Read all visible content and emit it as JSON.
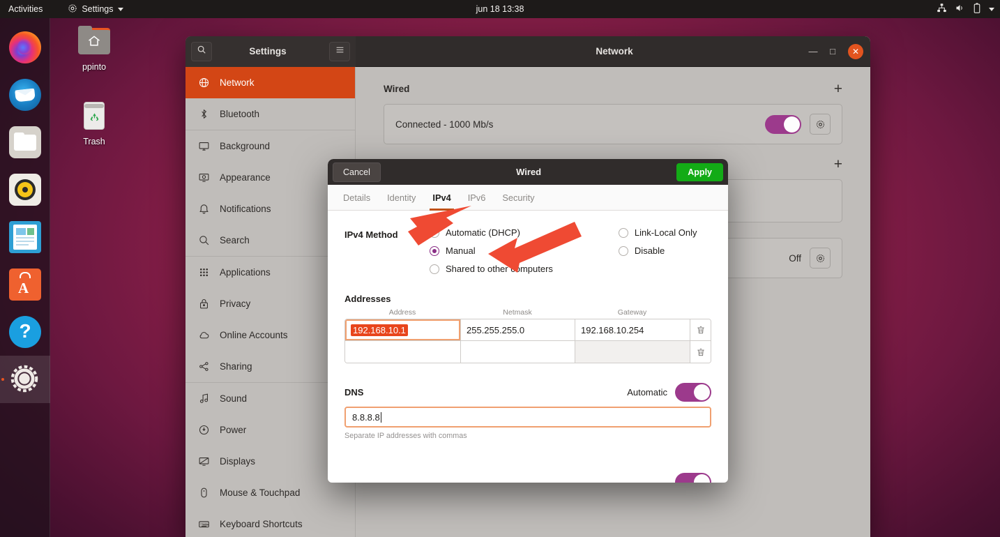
{
  "topbar": {
    "activities": "Activities",
    "app_menu": "Settings",
    "app_menu_icon": "gear-icon",
    "clock": "jun 18  13:38",
    "tray_icons": [
      "network-wired-icon",
      "volume-icon",
      "battery-icon",
      "chevron-down-icon"
    ]
  },
  "dock": {
    "items": [
      {
        "name": "firefox",
        "label": "Firefox",
        "active": false
      },
      {
        "name": "thunderbird",
        "label": "Thunderbird",
        "active": false
      },
      {
        "name": "files",
        "label": "Files",
        "active": false
      },
      {
        "name": "rhythmbox",
        "label": "Rhythmbox",
        "active": false
      },
      {
        "name": "libreoffice-writer",
        "label": "LibreOffice Writer",
        "active": false
      },
      {
        "name": "ubuntu-software",
        "label": "Ubuntu Software",
        "active": false
      },
      {
        "name": "help",
        "label": "Help",
        "active": false
      },
      {
        "name": "settings",
        "label": "Settings",
        "active": true
      }
    ]
  },
  "desktop": {
    "icons": [
      {
        "name": "home-folder",
        "label": "ppinto"
      },
      {
        "name": "trash",
        "label": "Trash"
      }
    ]
  },
  "window": {
    "left_title": "Settings",
    "right_title": "Network",
    "search_icon": "search-icon",
    "menu_icon": "hamburger-menu-icon",
    "minimize": "—",
    "maximize": "□",
    "close": "✕"
  },
  "sidebar": {
    "items": [
      {
        "label": "Network",
        "icon": "globe-icon",
        "selected": true,
        "sep_after": false
      },
      {
        "label": "Bluetooth",
        "icon": "bluetooth-icon",
        "selected": false,
        "sep_after": true
      },
      {
        "label": "Background",
        "icon": "monitor-icon",
        "selected": false,
        "sep_after": false
      },
      {
        "label": "Appearance",
        "icon": "appearance-icon",
        "selected": false,
        "sep_after": false
      },
      {
        "label": "Notifications",
        "icon": "bell-icon",
        "selected": false,
        "sep_after": false
      },
      {
        "label": "Search",
        "icon": "search-icon",
        "selected": false,
        "sep_after": true
      },
      {
        "label": "Applications",
        "icon": "grid-icon",
        "selected": false,
        "sep_after": false
      },
      {
        "label": "Privacy",
        "icon": "lock-icon",
        "selected": false,
        "sep_after": false
      },
      {
        "label": "Online Accounts",
        "icon": "cloud-icon",
        "selected": false,
        "sep_after": false
      },
      {
        "label": "Sharing",
        "icon": "share-icon",
        "selected": false,
        "sep_after": true
      },
      {
        "label": "Sound",
        "icon": "music-note-icon",
        "selected": false,
        "sep_after": false
      },
      {
        "label": "Power",
        "icon": "power-icon",
        "selected": false,
        "sep_after": false
      },
      {
        "label": "Displays",
        "icon": "display-icon",
        "selected": false,
        "sep_after": false
      },
      {
        "label": "Mouse & Touchpad",
        "icon": "mouse-icon",
        "selected": false,
        "sep_after": false
      },
      {
        "label": "Keyboard Shortcuts",
        "icon": "keyboard-icon",
        "selected": false,
        "sep_after": false
      }
    ]
  },
  "network_panel": {
    "wired_title": "Wired",
    "add_label": "+",
    "wired_status": "Connected - 1000 Mb/s",
    "wired_toggle_on": true,
    "second_add_label": "+",
    "off_label": "Off",
    "gear_icon": "gear-icon"
  },
  "dialog": {
    "cancel_label": "Cancel",
    "title": "Wired",
    "apply_label": "Apply",
    "tabs": [
      {
        "label": "Details",
        "active": false
      },
      {
        "label": "Identity",
        "active": false
      },
      {
        "label": "IPv4",
        "active": true
      },
      {
        "label": "IPv6",
        "active": false
      },
      {
        "label": "Security",
        "active": false
      }
    ],
    "method": {
      "label": "IPv4 Method",
      "options_left": [
        {
          "label": "Automatic (DHCP)",
          "selected": false
        },
        {
          "label": "Manual",
          "selected": true
        },
        {
          "label": "Shared to other computers",
          "selected": false
        }
      ],
      "options_right": [
        {
          "label": "Link-Local Only",
          "selected": false
        },
        {
          "label": "Disable",
          "selected": false
        }
      ]
    },
    "addresses": {
      "title": "Addresses",
      "columns": [
        "Address",
        "Netmask",
        "Gateway"
      ],
      "rows": [
        {
          "address": "192.168.10.1",
          "netmask": "255.255.255.0",
          "gateway": "192.168.10.254",
          "address_selected": true
        },
        {
          "address": "",
          "netmask": "",
          "gateway": "",
          "address_selected": false
        }
      ],
      "delete_icon": "trash-icon"
    },
    "dns": {
      "title": "DNS",
      "automatic_label": "Automatic",
      "automatic_on": true,
      "value": "8.8.8.8",
      "hint": "Separate IP addresses with commas"
    }
  },
  "annotations": {
    "arrows": [
      {
        "name": "arrow-to-ipv4-tab",
        "color": "#ef4a33"
      },
      {
        "name": "arrow-to-manual-radio",
        "color": "#ef4a33"
      }
    ]
  },
  "colors": {
    "ubuntu_orange": "#e95420",
    "sidebar_selected": "#d34615",
    "toggle_purple": "#9c3a8c",
    "apply_green": "#13ab16",
    "selection_orange": "#e8451c",
    "tab_underline": "#bf5118",
    "arrow_red": "#ef4a33"
  }
}
